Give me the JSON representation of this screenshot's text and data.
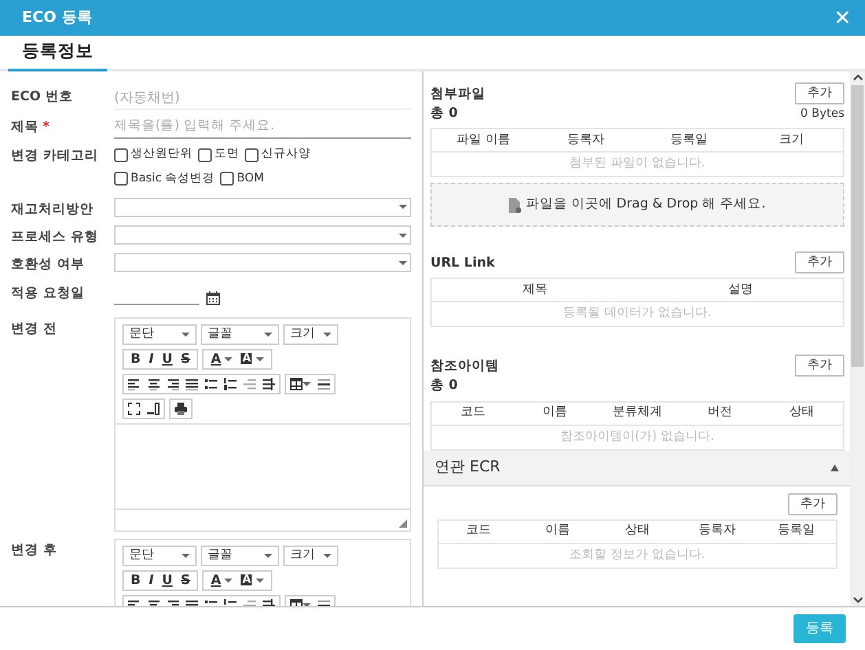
{
  "window": {
    "title": "ECO 등록",
    "close": "✕"
  },
  "tabs": [
    {
      "label": "등록정보",
      "selected": true
    }
  ],
  "form": [
    {
      "kind": "static",
      "label": "ECO 번호",
      "value": "(자동채번)"
    },
    {
      "kind": "text",
      "label": "제목",
      "required": true,
      "required_mark": "*",
      "placeholder": "제목을(를) 입력해 주세요."
    },
    {
      "kind": "checkboxes",
      "label": "변경 카테고리",
      "options": [
        {
          "label": "생산원단위",
          "checked": false
        },
        {
          "label": "도면",
          "checked": false
        },
        {
          "label": "신규사양",
          "checked": false
        },
        {
          "label": "Basic 속성변경",
          "checked": false
        },
        {
          "label": "BOM",
          "checked": false
        }
      ]
    },
    {
      "kind": "select",
      "label": "재고처리방안"
    },
    {
      "kind": "select",
      "label": "프로세스 유형"
    },
    {
      "kind": "select",
      "label": "호환성 여부"
    },
    {
      "kind": "date",
      "label": "적용 요청일"
    },
    {
      "kind": "editor",
      "label": "변경 전",
      "dropdowns": [
        "문단",
        "글꼴",
        "크기"
      ],
      "formats": [
        "B",
        "I",
        "U",
        "S"
      ],
      "colors": [
        "A",
        "A"
      ]
    },
    {
      "kind": "editor",
      "label": "변경 후",
      "dropdowns": [
        "문단",
        "글꼴",
        "크기"
      ],
      "formats": [
        "B",
        "I",
        "U",
        "S"
      ],
      "colors": [
        "A",
        "A"
      ]
    }
  ],
  "sections": [
    {
      "kind": "files",
      "title": "첨부파일",
      "add": "추가",
      "count": "총 0",
      "size": "0 Bytes",
      "columns": [
        "파일 이름",
        "등록자",
        "등록일",
        "크기"
      ],
      "empty": "첨부된 파일이 없습니다.",
      "drop": "파일을 이곳에 Drag & Drop 해 주세요."
    },
    {
      "kind": "table",
      "title": "URL Link",
      "add": "추가",
      "columns": [
        "제목",
        "설명"
      ],
      "empty": "등록될 데이터가 없습니다."
    },
    {
      "kind": "table",
      "title": "참조아이템",
      "add": "추가",
      "count": "총 0",
      "columns": [
        "코드",
        "이름",
        "분류체계",
        "버전",
        "상태"
      ],
      "empty": "참조아이템이(가) 없습니다."
    },
    {
      "kind": "panel",
      "title": "연관 ECR",
      "expanded": true,
      "add": "추가",
      "columns": [
        "코드",
        "이름",
        "상태",
        "등록자",
        "등록일"
      ],
      "empty": "조회할 정보가 없습니다."
    }
  ],
  "footer": {
    "submit": "등록"
  }
}
